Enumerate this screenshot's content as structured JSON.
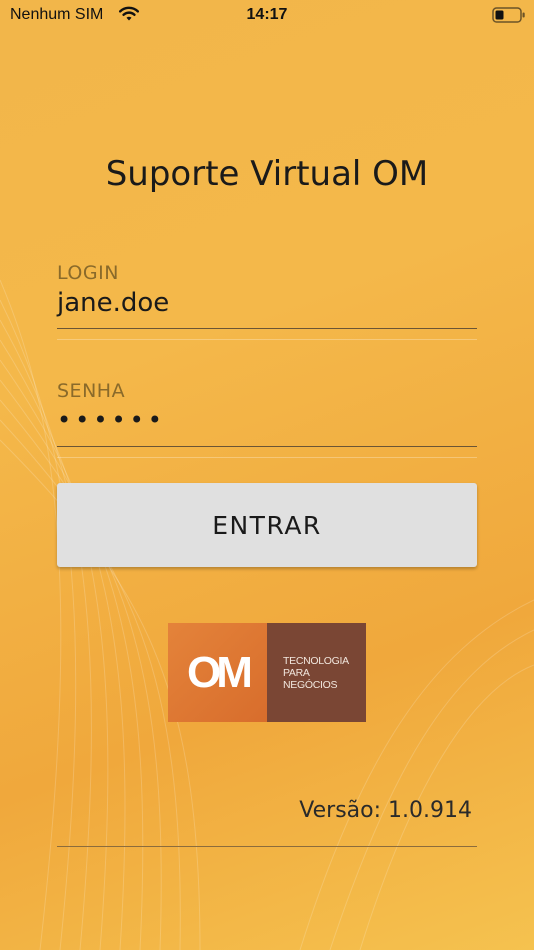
{
  "status_bar": {
    "carrier": "Nenhum SIM",
    "time": "14:17",
    "wifi_icon": "wifi-icon",
    "battery_icon": "battery-low-icon"
  },
  "app": {
    "title": "Suporte Virtual OM"
  },
  "login": {
    "label": "LOGIN",
    "value": "jane.doe"
  },
  "password": {
    "label": "SENHA",
    "masked_value": "••••••"
  },
  "enter_button": {
    "label": "ENTRAR"
  },
  "logo": {
    "mark": "OM",
    "tagline": [
      "TECNOLOGIA",
      "PARA",
      "NEGÓCIOS"
    ]
  },
  "footer": {
    "version": "Versão: 1.0.914"
  },
  "colors": {
    "background": "#f2b64a",
    "button": "#e0e0e0",
    "logo_orange": "#e07a34",
    "logo_brown": "#7a4634"
  }
}
